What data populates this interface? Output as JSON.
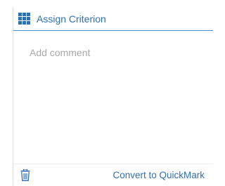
{
  "header": {
    "icon": "grid-icon",
    "label": "Assign Criterion"
  },
  "comment": {
    "placeholder": "Add comment",
    "value": ""
  },
  "footer": {
    "delete_icon": "trash-icon",
    "convert_label": "Convert to QuickMark"
  },
  "colors": {
    "accent": "#2f6fb6",
    "header_border": "#4a90d9",
    "placeholder": "#a8a8a8"
  }
}
